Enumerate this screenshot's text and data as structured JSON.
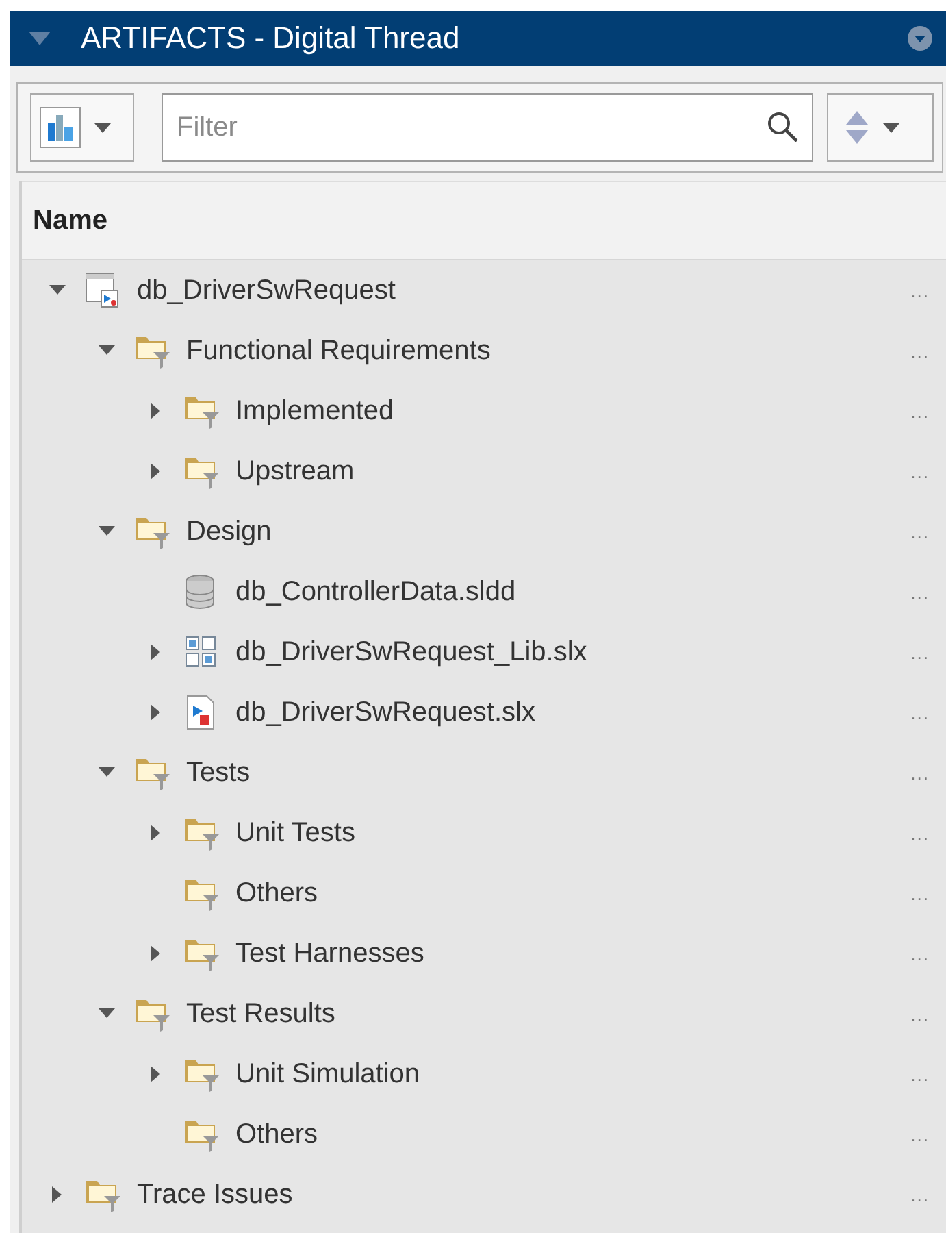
{
  "panel": {
    "title": "ARTIFACTS - Digital Thread"
  },
  "toolbar": {
    "filter": {
      "placeholder": "Filter"
    }
  },
  "table": {
    "columns": [
      "Name"
    ],
    "rows": [
      {
        "name": "db_DriverSwRequest",
        "kind": "model",
        "expandable": true,
        "expanded": true,
        "more": "...",
        "children": [
          {
            "name": "Functional Requirements",
            "kind": "folder",
            "expandable": true,
            "expanded": true,
            "more": "...",
            "children": [
              {
                "name": "Implemented",
                "kind": "folder",
                "expandable": true,
                "expanded": false,
                "more": "..."
              },
              {
                "name": "Upstream",
                "kind": "folder",
                "expandable": true,
                "expanded": false,
                "more": "..."
              }
            ]
          },
          {
            "name": "Design",
            "kind": "folder",
            "expandable": true,
            "expanded": true,
            "more": "...",
            "children": [
              {
                "name": "db_ControllerData.sldd",
                "kind": "data",
                "more": "..."
              },
              {
                "name": "db_DriverSwRequest_Lib.slx",
                "kind": "library",
                "expandable": true,
                "expanded": false,
                "more": "..."
              },
              {
                "name": "db_DriverSwRequest.slx",
                "kind": "slx",
                "expandable": true,
                "expanded": false,
                "more": "..."
              }
            ]
          },
          {
            "name": "Tests",
            "kind": "folder",
            "expandable": true,
            "expanded": true,
            "more": "...",
            "children": [
              {
                "name": "Unit Tests",
                "kind": "folder",
                "expandable": true,
                "expanded": false,
                "more": "..."
              },
              {
                "name": "Others",
                "kind": "folder",
                "more": "..."
              },
              {
                "name": "Test Harnesses",
                "kind": "folder",
                "expandable": true,
                "expanded": false,
                "more": "..."
              }
            ]
          },
          {
            "name": "Test Results",
            "kind": "folder",
            "expandable": true,
            "expanded": true,
            "more": "...",
            "children": [
              {
                "name": "Unit Simulation",
                "kind": "folder",
                "expandable": true,
                "expanded": false,
                "more": "..."
              },
              {
                "name": "Others",
                "kind": "folder",
                "more": "..."
              }
            ]
          }
        ]
      },
      {
        "name": "Trace Issues",
        "kind": "folder",
        "expandable": true,
        "expanded": false,
        "more": "..."
      }
    ]
  }
}
